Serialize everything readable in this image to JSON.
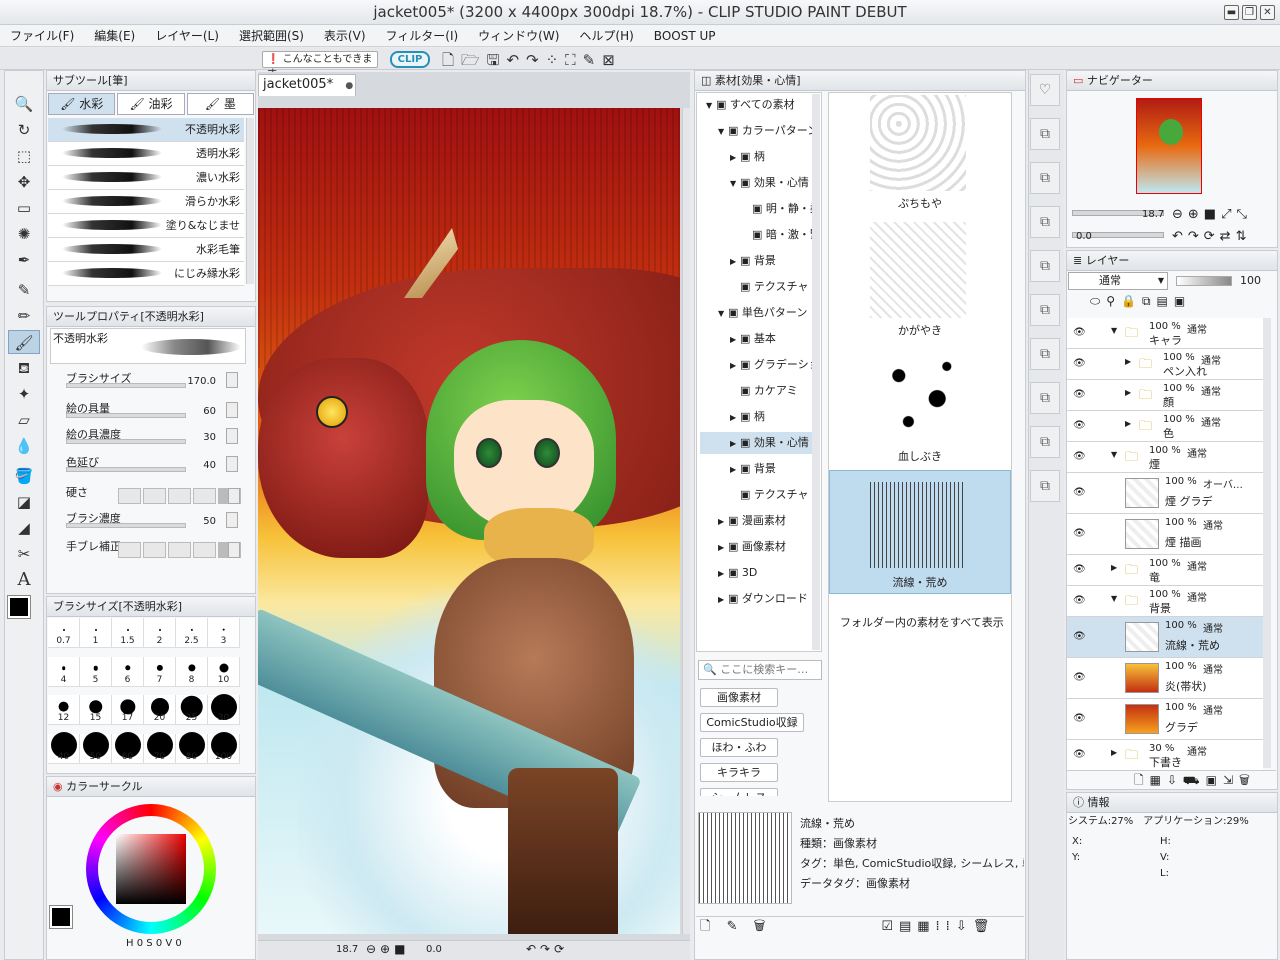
{
  "window": {
    "title": "jacket005* (3200 x 4400px 300dpi 18.7%) - CLIP STUDIO PAINT DEBUT",
    "min": "▬",
    "max": "❐",
    "close": "✕"
  },
  "menu": [
    "ファイル(F)",
    "編集(E)",
    "レイヤー(L)",
    "選択範囲(S)",
    "表示(V)",
    "フィルター(I)",
    "ウィンドウ(W)",
    "ヘルプ(H)",
    "BOOST UP"
  ],
  "toolbar": {
    "tip": "こんなこともできます",
    "logo": "CLIP"
  },
  "doc_tab": {
    "name": "jacket005*",
    "close": "●"
  },
  "subtool": {
    "header": "サブツール[筆]",
    "tabs": [
      "水彩",
      "油彩",
      "墨"
    ],
    "brushes": [
      "不透明水彩",
      "透明水彩",
      "濃い水彩",
      "滑らか水彩",
      "塗り&なじませ",
      "水彩毛筆",
      "にじみ縁水彩"
    ]
  },
  "toolprop": {
    "header": "ツールプロパティ[不透明水彩]",
    "preset": "不透明水彩",
    "props": [
      {
        "name": "ブラシサイズ",
        "value": "170.0"
      },
      {
        "name": "絵の具量",
        "value": "60"
      },
      {
        "name": "絵の具濃度",
        "value": "30"
      },
      {
        "name": "色延び",
        "value": "40"
      },
      {
        "name": "硬さ",
        "value": ""
      },
      {
        "name": "ブラシ濃度",
        "value": "50"
      },
      {
        "name": "手ブレ補正",
        "value": ""
      }
    ]
  },
  "brushsize": {
    "header": "ブラシサイズ[不透明水彩]",
    "sizes": [
      "0.7",
      "1",
      "1.5",
      "2",
      "2.5",
      "3",
      "4",
      "5",
      "6",
      "7",
      "8",
      "10",
      "12",
      "15",
      "17",
      "20",
      "25",
      "30",
      "40",
      "50",
      "60",
      "70",
      "80",
      "100"
    ]
  },
  "colorcircle": {
    "header": "カラーサークル",
    "h": "0",
    "s": "0",
    "v": "0",
    "hl": "H",
    "sl": "S",
    "vl": "V"
  },
  "canvas_status": {
    "zoom": "18.7",
    "angle": "0.0"
  },
  "material": {
    "header": "素材[効果・心情]",
    "tree": [
      {
        "label": "すべての素材",
        "indent": 0,
        "arrow": "▼"
      },
      {
        "label": "カラーパターン",
        "indent": 1,
        "arrow": "▼"
      },
      {
        "label": "柄",
        "indent": 2,
        "arrow": "▶"
      },
      {
        "label": "効果・心情",
        "indent": 2,
        "arrow": "▼"
      },
      {
        "label": "明・静・柔",
        "indent": 3,
        "arrow": ""
      },
      {
        "label": "暗・激・緊",
        "indent": 3,
        "arrow": ""
      },
      {
        "label": "背景",
        "indent": 2,
        "arrow": "▶"
      },
      {
        "label": "テクスチャ",
        "indent": 2,
        "arrow": ""
      },
      {
        "label": "単色パターン",
        "indent": 1,
        "arrow": "▼"
      },
      {
        "label": "基本",
        "indent": 2,
        "arrow": "▶"
      },
      {
        "label": "グラデーション",
        "indent": 2,
        "arrow": "▶"
      },
      {
        "label": "カケアミ",
        "indent": 2,
        "arrow": ""
      },
      {
        "label": "柄",
        "indent": 2,
        "arrow": "▶"
      },
      {
        "label": "効果・心情",
        "indent": 2,
        "arrow": "▶"
      },
      {
        "label": "背景",
        "indent": 2,
        "arrow": "▶"
      },
      {
        "label": "テクスチャ",
        "indent": 2,
        "arrow": ""
      },
      {
        "label": "漫画素材",
        "indent": 1,
        "arrow": "▶"
      },
      {
        "label": "画像素材",
        "indent": 1,
        "arrow": "▶"
      },
      {
        "label": "3D",
        "indent": 1,
        "arrow": "▶"
      },
      {
        "label": "ダウンロード",
        "indent": 1,
        "arrow": "▶"
      }
    ],
    "search_placeholder": "ここに検索キー…",
    "chips": [
      "画像素材",
      "ComicStudio収録",
      "ほわ・ふわ",
      "キラキラ",
      "シームレス"
    ],
    "items": [
      "ぷちもや",
      "かがやき",
      "血しぶき",
      "流線・荒め"
    ],
    "show_all": "フォルダー内の素材をすべて表示",
    "detail": {
      "name": "流線・荒め",
      "type": "種類：画像素材",
      "tags": "タグ：単色, ComicStudio収録, シームレス, 単",
      "datatag": "データタグ：画像素材"
    }
  },
  "navigator": {
    "header": "ナビゲーター",
    "zoom": "18.7",
    "angle": "0.0"
  },
  "layers": {
    "header": "レイヤー",
    "blend": "通常",
    "opacity": "100",
    "rows": [
      {
        "pct": "100 %",
        "mode": "通常",
        "name": "キャラ",
        "folder": true,
        "open": true,
        "indent": 0
      },
      {
        "pct": "100 %",
        "mode": "通常",
        "name": "ペン入れ",
        "folder": true,
        "open": false,
        "indent": 1
      },
      {
        "pct": "100 %",
        "mode": "通常",
        "name": "顔",
        "folder": true,
        "open": false,
        "indent": 1
      },
      {
        "pct": "100 %",
        "mode": "通常",
        "name": "色",
        "folder": true,
        "open": false,
        "indent": 1
      },
      {
        "pct": "100 %",
        "mode": "通常",
        "name": "煙",
        "folder": true,
        "open": true,
        "indent": 0
      },
      {
        "pct": "100 %",
        "mode": "オーバ…",
        "name": "煙 グラデ",
        "folder": false,
        "indent": 1
      },
      {
        "pct": "100 %",
        "mode": "通常",
        "name": "煙 描画",
        "folder": false,
        "indent": 1
      },
      {
        "pct": "100 %",
        "mode": "通常",
        "name": "竜",
        "folder": true,
        "open": false,
        "indent": 0
      },
      {
        "pct": "100 %",
        "mode": "通常",
        "name": "背景",
        "folder": true,
        "open": true,
        "indent": 0
      },
      {
        "pct": "100 %",
        "mode": "通常",
        "name": "流線・荒め",
        "folder": false,
        "indent": 1
      },
      {
        "pct": "100 %",
        "mode": "通常",
        "name": "炎(帯状)",
        "folder": false,
        "indent": 1
      },
      {
        "pct": "100 %",
        "mode": "通常",
        "name": "グラデ",
        "folder": false,
        "indent": 1
      },
      {
        "pct": "30 %",
        "mode": "通常",
        "name": "下書き",
        "folder": true,
        "open": false,
        "indent": 0
      }
    ]
  },
  "info": {
    "header": "情報",
    "system": "システム:27%",
    "app": "アプリケーション:29%",
    "x": "X:",
    "y": "Y:",
    "h": "H:",
    "v": "V:",
    "l": "L:"
  }
}
